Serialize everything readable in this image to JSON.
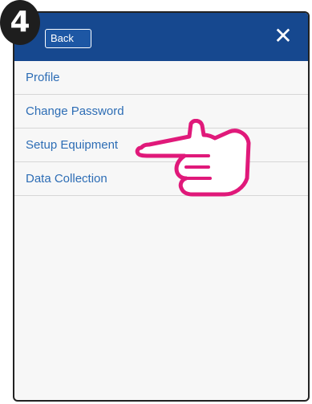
{
  "step_number": "4",
  "header": {
    "back_label": "Back",
    "close_symbol": "✕"
  },
  "menu": {
    "items": [
      {
        "label": "Profile"
      },
      {
        "label": "Change Password"
      },
      {
        "label": "Setup Equipment"
      },
      {
        "label": "Data Collection"
      }
    ]
  },
  "colors": {
    "header": "#16488f",
    "menu_text": "#2d6db5",
    "pointer": "#e0197a"
  },
  "icons": {
    "pointer": "pointing-hand-icon",
    "close": "close-icon"
  }
}
